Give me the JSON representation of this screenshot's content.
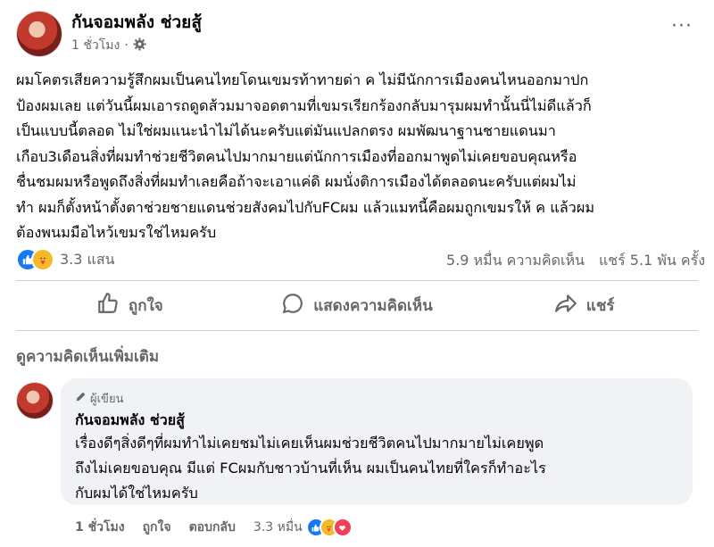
{
  "post": {
    "author": "กันจอมพลัง ช่วยสู้",
    "time": "1 ชั่วโมง",
    "separator": "·",
    "more": "···",
    "body_lines": [
      "ผมโคตรเสียความรู้สึกผมเป็นคนไทยโดนเขมรท้าทายด่า ค ไม่มีนักการเมืองคนไหนออกมาปก",
      "ป้องผมเลย แต่วันนี้ผมเอารถดูดส้วมมาจอดตามที่เขมรเรียกร้องกลับมารุมผมทำนั้นนี่ไม่ดีแล้วก็",
      "เป็นแบบนี้ตลอด ไม่ใช่ผมแนะนำไม่ได้นะครับแต่มันแปลกตรง ผมพัฒนาฐานชายแดนมา",
      "เกือบ3เดือนสิ่งที่ผมทำช่วยชีวิตคนไปมากมายแต่นักการเมืองที่ออกมาพูดไม่เคยขอบคุณหรือ",
      "ชื่นชมผมหรือพูดถึงสิ่งที่ผมทำเลยคือถ้าจะเอาแค่ดิ ผมนั่งติการเมืองได้ตลอดนะครับแต่ผมไม่",
      "ทำ ผมก็ตั้งหน้าตั้งตาช่วยชายแดนช่วยสังคมไปกับFCผม แล้วแมทนี้คือผมถูกเขมรให้ ค แล้วผม",
      "ต้องพนมมือไหว้เขมรใช่ไหมครับ"
    ]
  },
  "stats": {
    "reactions": "3.3 แสน",
    "comments": "5.9 หมื่น ความคิดเห็น",
    "shares": "แชร์ 5.1 พัน ครั้ง"
  },
  "actions": {
    "like": "ถูกใจ",
    "comment": "แสดงความคิดเห็น",
    "share": "แชร์"
  },
  "more_comments": "ดูความคิดเห็นเพิ่มเติม",
  "comment": {
    "badge": "ผู้เขียน",
    "author": "กันจอมพลัง ช่วยสู้",
    "lines": [
      "เรื่องดีๆสิ่งดีๆที่ผมทำไม่เคยชมไม่เคยเห็นผมช่วยชีวิตคนไปมากมายไม่เคยพูด",
      "ถึงไม่เคยขอบคุณ มีแต่ FCผมกับชาวบ้านที่เห็น ผมเป็นคนไทยที่ใครก็ทำอะไร",
      "กับผมได้ใช่ไหมครับ"
    ],
    "time": "1 ชั่วโมง",
    "like": "ถูกใจ",
    "reply": "ตอบกลับ",
    "reactions": "3.3 หมื่น"
  },
  "colors": {
    "like_blue": "#1877f2",
    "care_yellow": "#f7b928",
    "love_red": "#f33e58",
    "muted": "#65676b",
    "bubble": "#f0f2f5"
  }
}
